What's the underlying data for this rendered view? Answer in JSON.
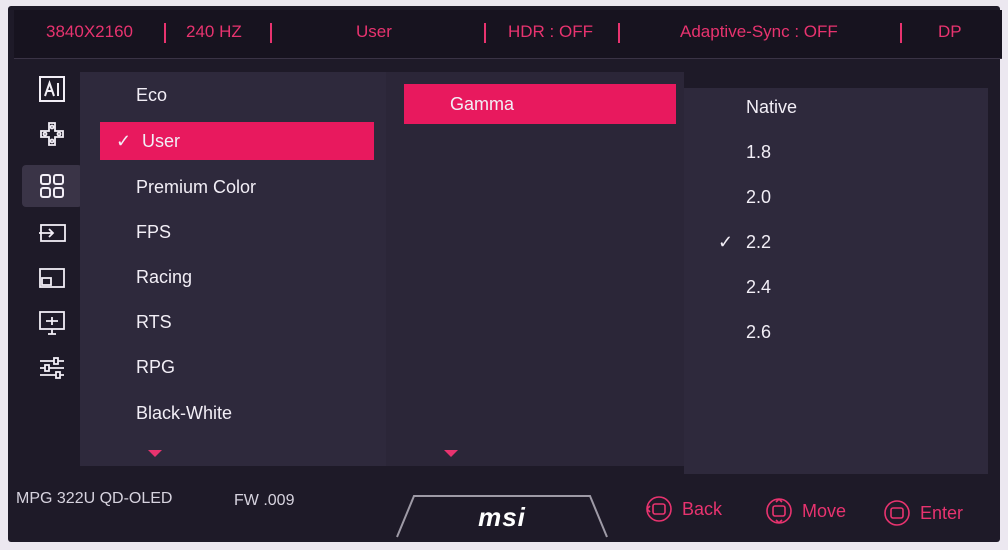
{
  "status_bar": {
    "resolution": "3840X2160",
    "refresh_rate": "240 HZ",
    "mode": "User",
    "hdr": "HDR : OFF",
    "adaptive_sync": "Adaptive-Sync : OFF",
    "input": "DP"
  },
  "side_icons": [
    "ai-icon",
    "gamepad-icon",
    "apps-grid-icon",
    "input-source-icon",
    "pip-icon",
    "display-icon",
    "settings-sliders-icon"
  ],
  "mode_list": {
    "items": [
      "Eco",
      "User",
      "Premium Color",
      "FPS",
      "Racing",
      "RTS",
      "RPG",
      "Black-White"
    ],
    "selected": "User"
  },
  "sub_menu": {
    "items": [
      "Gamma"
    ],
    "selected": "Gamma"
  },
  "gamma_options": {
    "items": [
      "Native",
      "1.8",
      "2.0",
      "2.2",
      "2.4",
      "2.6"
    ],
    "checked": "2.2"
  },
  "footer": {
    "model": "MPG 322U QD-OLED",
    "firmware": "FW .009",
    "brand": "msi",
    "back_label": "Back",
    "move_label": "Move",
    "enter_label": "Enter"
  },
  "colors": {
    "accent": "#e8195e",
    "background": "#1e1a28"
  }
}
